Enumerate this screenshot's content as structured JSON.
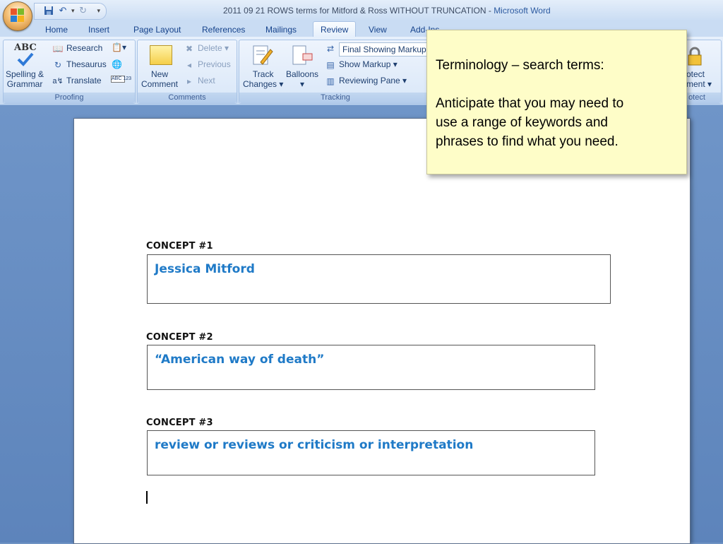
{
  "window": {
    "title": "2011 09 21 ROWS terms for Mitford & Ross WITHOUT TRUNCATION",
    "title_sep": " - ",
    "app": "Microsoft Word"
  },
  "tabs": [
    "Home",
    "Insert",
    "Page Layout",
    "References",
    "Mailings",
    "Review",
    "View",
    "Add-Ins"
  ],
  "active_tab": "Review",
  "ribbon": {
    "proofing": {
      "label": "Proofing",
      "spelling_line1": "Spelling &",
      "spelling_line2": "Grammar",
      "spelling_icon_text": "ABC",
      "research": "Research",
      "thesaurus": "Thesaurus",
      "translate": "Translate",
      "wordcount_icon_text": "ABC 123"
    },
    "comments": {
      "label": "Comments",
      "new_line1": "New",
      "new_line2": "Comment",
      "delete": "Delete",
      "previous": "Previous",
      "next": "Next"
    },
    "tracking": {
      "label": "Tracking",
      "track_line1": "Track",
      "track_line2": "Changes",
      "balloons": "Balloons",
      "final_showing_markup": "Final Showing Markup",
      "show_markup": "Show Markup",
      "reviewing_pane": "Reviewing Pane"
    },
    "protect": {
      "label": "otect",
      "line1": "otect",
      "line2": "ment"
    }
  },
  "document": {
    "concepts": [
      {
        "label": "CONCEPT #1",
        "text": "Jessica Mitford"
      },
      {
        "label": "CONCEPT #2",
        "text": "“American way of death”"
      },
      {
        "label": "CONCEPT #3",
        "text": "review or reviews or criticism or interpretation"
      }
    ]
  },
  "note": {
    "heading": "Terminology – search terms:",
    "line1": "Anticipate that you may need to",
    "line2": "use a range of keywords and",
    "line3": "phrases to find what you need."
  },
  "colors": {
    "concept_text": "#1f7ac7",
    "note_bg": "#fefdc8",
    "workspace": "#6f93c4"
  }
}
